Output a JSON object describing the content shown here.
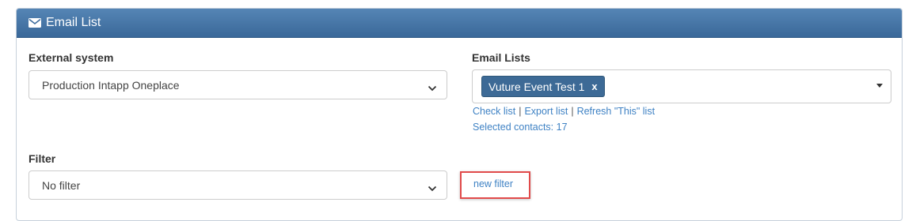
{
  "panel": {
    "title": "Email List",
    "icon": "envelope-icon",
    "header_color": "#3f6e9f"
  },
  "external_system": {
    "label": "External system",
    "selected": "Production Intapp Oneplace"
  },
  "email_lists": {
    "label": "Email Lists",
    "selected_tag": "Vuture Event Test 1",
    "remove_glyph": "x",
    "links": {
      "check_list": "Check list",
      "separator": "|",
      "export_list": "Export list",
      "refresh_list": "Refresh \"This\" list"
    },
    "selected_contacts": "Selected contacts: 17"
  },
  "filter": {
    "label": "Filter",
    "selected": "No filter",
    "new_filter_link": "new filter"
  },
  "colors": {
    "link": "#3f82c4",
    "tag_bg": "#3d6a96",
    "highlight": "#e14a4a"
  }
}
